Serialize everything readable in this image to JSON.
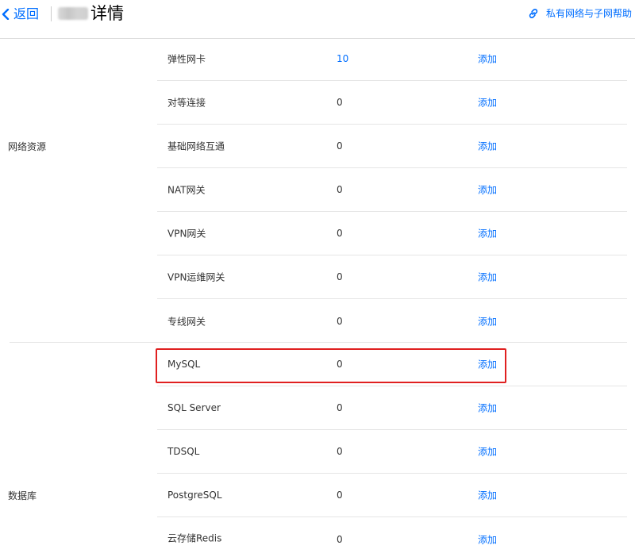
{
  "header": {
    "back_label": "返回",
    "title": "详情",
    "help_label": "私有网络与子网帮助"
  },
  "groups": [
    {
      "label": "网络资源",
      "rows": [
        {
          "name": "弹性网卡",
          "count": "10",
          "action": "添加"
        },
        {
          "name": "对等连接",
          "count": "0",
          "action": "添加"
        },
        {
          "name": "基础网络互通",
          "count": "0",
          "action": "添加"
        },
        {
          "name": "NAT网关",
          "count": "0",
          "action": "添加"
        },
        {
          "name": "VPN网关",
          "count": "0",
          "action": "添加"
        },
        {
          "name": "VPN运维网关",
          "count": "0",
          "action": "添加"
        },
        {
          "name": "专线网关",
          "count": "0",
          "action": "添加"
        }
      ]
    },
    {
      "label": "数据库",
      "rows": [
        {
          "name": "MySQL",
          "count": "0",
          "action": "添加"
        },
        {
          "name": "SQL Server",
          "count": "0",
          "action": "添加"
        },
        {
          "name": "TDSQL",
          "count": "0",
          "action": "添加"
        },
        {
          "name": "PostgreSQL",
          "count": "0",
          "action": "添加"
        },
        {
          "name": "云存储Redis",
          "count": "0",
          "action": "添加"
        }
      ]
    }
  ],
  "colors": {
    "accent": "#006eff",
    "highlight": "#e02020",
    "divider": "#e5e5e5"
  },
  "icons": {
    "back": "chevron-left-icon",
    "help": "link-icon"
  }
}
